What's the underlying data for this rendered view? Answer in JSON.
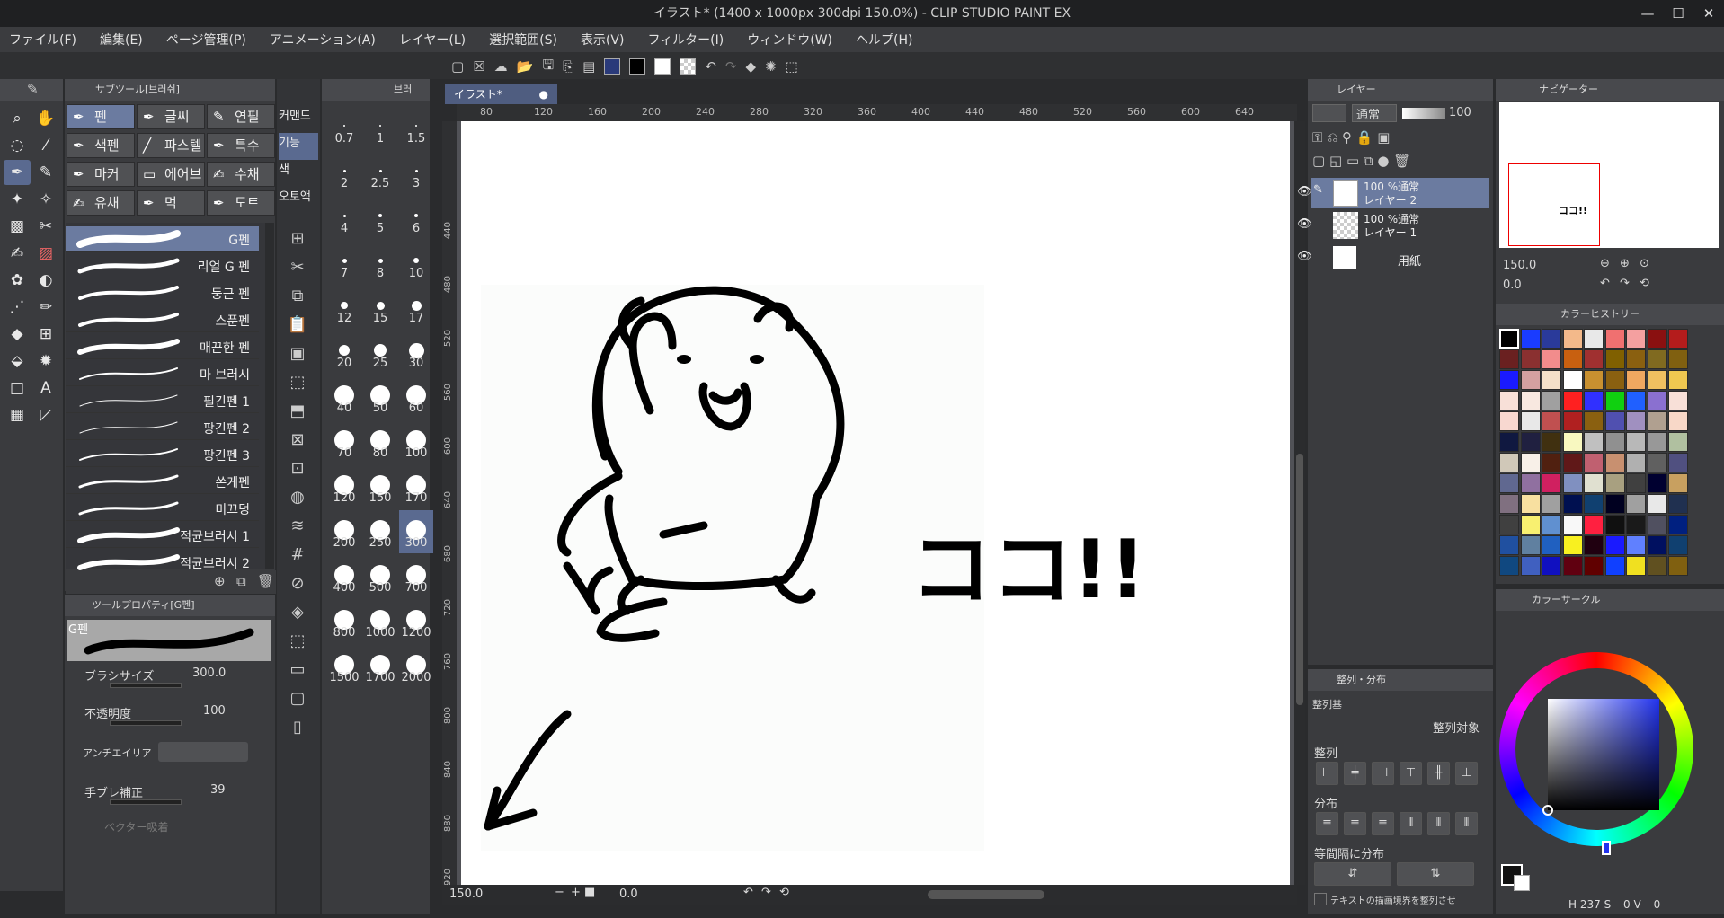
{
  "window": {
    "title": "イラスト* (1400 x 1000px 300dpi 150.0%)  - CLIP STUDIO PAINT EX",
    "min": "—",
    "max": "☐",
    "close": "✕"
  },
  "menu": [
    "ファイル(F)",
    "編集(E)",
    "ページ管理(P)",
    "アニメーション(A)",
    "レイヤー(L)",
    "選択範囲(S)",
    "表示(V)",
    "フィルター(I)",
    "ウィンドウ(W)",
    "ヘルプ(H)"
  ],
  "subtool": {
    "header": "サブツール[브러쉬]",
    "buttons": [
      "펜",
      "글씨",
      "연필",
      "색펜",
      "파스텔",
      "특수",
      "마커",
      "에어브",
      "수채",
      "유채",
      "먹",
      "도트"
    ],
    "brushes": [
      "G펜",
      "리얼 G 펜",
      "둥근 펜",
      "스푼펜",
      "매끈한 펜",
      "마 브러시",
      "필긴펜 1",
      "팡긴펜 2",
      "팡긴펜 3",
      "쏜게펜",
      "미끄덩",
      "적균브러시 1",
      "적균브러시 2"
    ]
  },
  "brushsize": {
    "header": "브러",
    "sizes": [
      "0.7",
      "1",
      "1.5",
      "2",
      "2.5",
      "3",
      "4",
      "5",
      "6",
      "7",
      "8",
      "10",
      "12",
      "15",
      "17",
      "20",
      "25",
      "30",
      "40",
      "50",
      "60",
      "70",
      "80",
      "100",
      "120",
      "150",
      "170",
      "200",
      "250",
      "300",
      "400",
      "500",
      "700",
      "800",
      "1000",
      "1200",
      "1500",
      "1700",
      "2000"
    ],
    "selected": "300"
  },
  "commands": [
    "커맨드",
    "기능",
    "색",
    "오토액"
  ],
  "toolprop": {
    "header": "ツールプロパティ[G펜]",
    "preview_name": "G펜",
    "brush_size_label": "ブラシサイズ",
    "brush_size": "300.0",
    "opacity_label": "不透明度",
    "opacity": "100",
    "antialias_label": "アンチエイリア",
    "stabilize_label": "手ブレ補正",
    "stabilize": "39",
    "vector_label": "ベクター吸着"
  },
  "canvas": {
    "tab": "イラスト*",
    "zoom": "150.0",
    "angle": "0.0",
    "ruler_h": [
      "80",
      "120",
      "160",
      "200",
      "240",
      "280",
      "320",
      "360",
      "400",
      "440",
      "480",
      "520",
      "560",
      "600",
      "640"
    ],
    "ruler_v": [
      "440",
      "480",
      "520",
      "560",
      "600",
      "640",
      "680",
      "720",
      "760",
      "800",
      "840",
      "880",
      "920"
    ],
    "drawing_text": "ココ!!"
  },
  "layers": {
    "header": "レイヤー",
    "blend": "通常",
    "opacity": "100",
    "items": [
      {
        "pct": "100 %通常",
        "name": "レイヤー 2"
      },
      {
        "pct": "100 %通常",
        "name": "レイヤー 1"
      },
      {
        "pct": "",
        "name": "用紙"
      }
    ]
  },
  "navigator": {
    "header": "ナビゲーター",
    "zoom": "150.0",
    "angle": "0.0",
    "thumb_text": "ココ!!"
  },
  "history": {
    "header": "カラーヒストリー",
    "colors": [
      "#000000",
      "#1a3cff",
      "#2a3a9a",
      "#f3b98a",
      "#e8e8e8",
      "#f07070",
      "#f4a0a0",
      "#8a1010",
      "#b41c1c",
      "#6a2020",
      "#8a3030",
      "#f28c8c",
      "#c86010",
      "#a03030",
      "#806000",
      "#8a6010",
      "#806a20",
      "#806010",
      "#1a1aff",
      "#d4a0a0",
      "#f4e0c8",
      "#ffffff",
      "#c89030",
      "#8a6010",
      "#f0a860",
      "#f0c060",
      "#f0c850",
      "#f8e0d8",
      "#f8e8e0",
      "#a0a0a0",
      "#ff2020",
      "#3030ff",
      "#10d010",
      "#2060ff",
      "#8a70d0",
      "#f8e0d8",
      "#f8d8d0",
      "#e8e8e8",
      "#c05050",
      "#b02020",
      "#8a6010",
      "#5050b0",
      "#a090c0",
      "#b0a090",
      "#f8d8c8",
      "#101840",
      "#202040",
      "#403010",
      "#f8f8c0",
      "#c0c0c0",
      "#909090",
      "#b8b8b8",
      "#989898",
      "#b0c0a0",
      "#d0c8b8",
      "#f8f0e8",
      "#502010",
      "#601818",
      "#c06070",
      "#c89070",
      "#b0b0b0",
      "#606060",
      "#505080",
      "#606890",
      "#9070a0",
      "#d02060",
      "#8090c0",
      "#e0e0d0",
      "#a8a080",
      "#404040",
      "#000030",
      "#c8a060",
      "#807080",
      "#f8e0a0",
      "#a0a0a0",
      "#001050",
      "#104070",
      "#000020",
      "#a0a0a0",
      "#e8e8e8",
      "#203050",
      "#404040",
      "#f8f070",
      "#6090d0",
      "#f8f8f8",
      "#ff2040",
      "#101010",
      "#1a1a1a",
      "#505060",
      "#002080",
      "#2050a0",
      "#6080a0",
      "#2060c0",
      "#f8f020",
      "#200010",
      "#1a1aff",
      "#6080ff",
      "#001060",
      "#104070",
      "#104880",
      "#4060c0",
      "#1010c0",
      "#600010",
      "#600000",
      "#1040ff",
      "#f0e020",
      "#605020",
      "#806010",
      "#c0c040",
      "#f0a020",
      "#e0c040",
      "#101010",
      "#303030"
    ]
  },
  "colorcircle": {
    "header": "カラーサークル",
    "h": "237",
    "s": "0",
    "v": "0",
    "h_label": "H",
    "s_label": "S",
    "v_label": "V"
  },
  "align": {
    "header": "整列・分布",
    "target_label": "整列対象",
    "row_label": "整列基",
    "align_label": "整列",
    "dist_label": "分布",
    "eq_label": "等間隔に分布",
    "checkbox_label": "テキストの描画境界を整列させ"
  }
}
